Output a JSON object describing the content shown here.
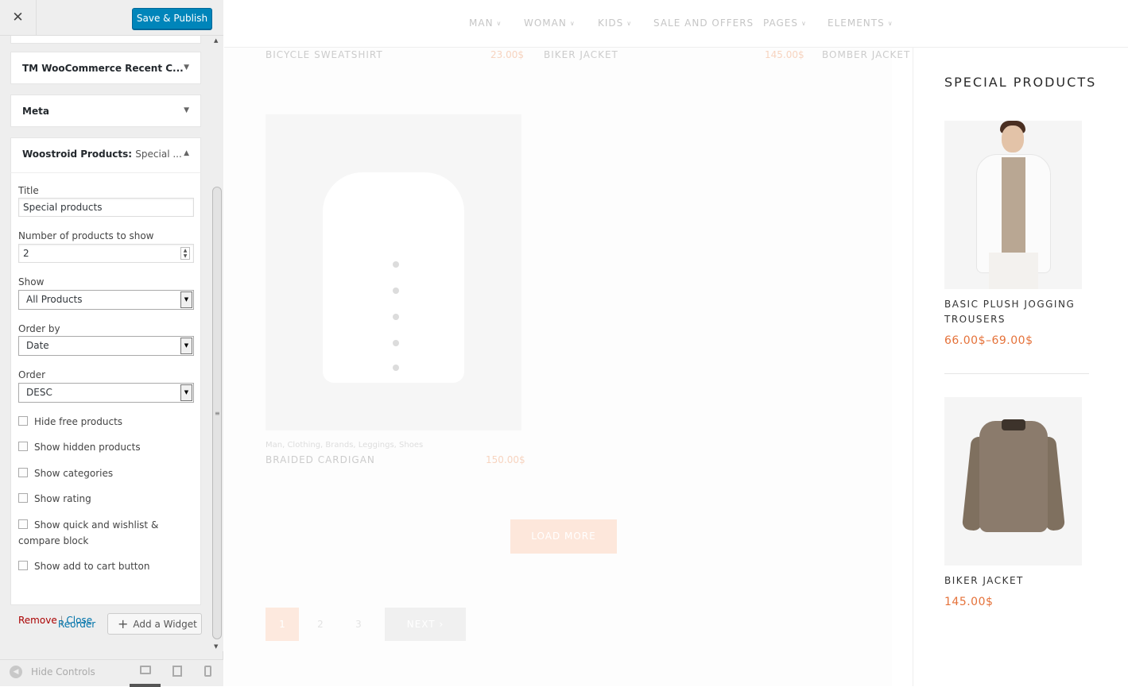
{
  "customizer": {
    "close_symbol": "✕",
    "save_label": "Save & Publish",
    "widgets": [
      {
        "title": "TM WooCommerce Recent C...",
        "subtitle": "",
        "expanded": false,
        "arrow": "▼"
      },
      {
        "title": "Meta",
        "subtitle": "",
        "expanded": false,
        "arrow": "▼"
      },
      {
        "title": "Woostroid Products:",
        "subtitle": "Special ...",
        "expanded": true,
        "arrow": "▲"
      }
    ],
    "form": {
      "title_label": "Title",
      "title_value": "Special products",
      "count_label": "Number of products to show",
      "count_value": "2",
      "show_label": "Show",
      "show_value": "All Products",
      "orderby_label": "Order by",
      "orderby_value": "Date",
      "order_label": "Order",
      "order_value": "DESC",
      "checkboxes": [
        {
          "label": "Hide free products",
          "checked": false
        },
        {
          "label": "Show hidden products",
          "checked": false
        },
        {
          "label": "Show categories",
          "checked": false
        },
        {
          "label": "Show rating",
          "checked": false
        },
        {
          "label": "Show quick and wishlist & compare block",
          "checked": false
        },
        {
          "label": "Show add to cart button",
          "checked": false
        }
      ],
      "remove_label": "Remove",
      "separator": "|",
      "close_label": "Close"
    },
    "reorder_label": "Reorder",
    "add_widget_label": "Add a Widget",
    "hide_controls_label": "Hide Controls"
  },
  "preview": {
    "nav": [
      "MAN",
      "WOMAN",
      "KIDS",
      "SALE AND OFFERS",
      "PAGES",
      "ELEMENTS"
    ],
    "nav_has_caret": [
      true,
      true,
      true,
      false,
      true,
      true
    ],
    "top_products": [
      {
        "name": "BICYCLE SWEATSHIRT",
        "price": "23.00$"
      },
      {
        "name": "BIKER JACKET",
        "price": "145.00$"
      },
      {
        "name": "BOMBER JACKET",
        "price": ""
      }
    ],
    "cardigan": {
      "tags": "Man, Clothing, Brands, Leggings, Shoes",
      "name": "BRAIDED CARDIGAN",
      "price": "150.00$"
    },
    "load_more_label": "LOAD MORE",
    "pagination": {
      "pages": [
        "1",
        "2",
        "3"
      ],
      "current": "1",
      "next_label": "NEXT ›"
    },
    "special": {
      "title": "SPECIAL PRODUCTS",
      "items": [
        {
          "name": "BASIC PLUSH JOGGING TROUSERS",
          "price": "66.00$–69.00$"
        },
        {
          "name": "BIKER JACKET",
          "price": "145.00$"
        }
      ]
    }
  },
  "colors": {
    "primary_button": "#0085ba",
    "link": "#0073aa",
    "remove": "#a00000",
    "price_accent": "#e5723a"
  }
}
